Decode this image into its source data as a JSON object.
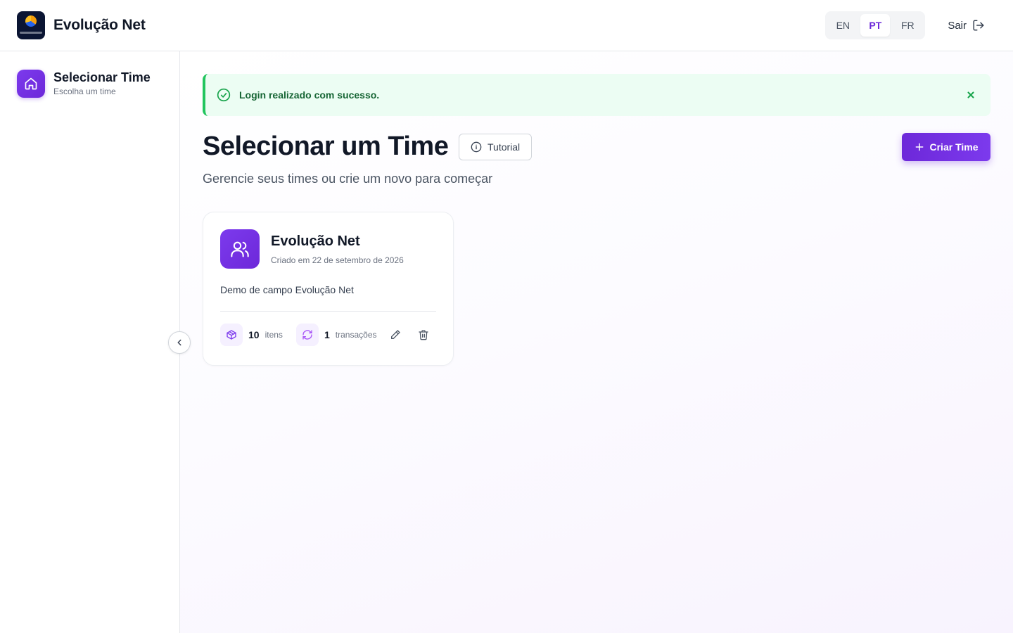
{
  "app": {
    "title": "Evolução Net"
  },
  "header": {
    "languages": [
      {
        "code": "EN",
        "active": false
      },
      {
        "code": "PT",
        "active": true
      },
      {
        "code": "FR",
        "active": false
      }
    ],
    "logout_label": "Sair"
  },
  "sidebar": {
    "item": {
      "title": "Selecionar Time",
      "subtitle": "Escolha um time",
      "icon": "home-icon"
    }
  },
  "alert": {
    "message": "Login realizado com sucesso.",
    "type": "success"
  },
  "main": {
    "title": "Selecionar um Time",
    "tutorial_label": "Tutorial",
    "create_label": "Criar Time",
    "subtitle": "Gerencie seus times ou crie um novo para começar"
  },
  "teams": [
    {
      "name": "Evolução Net",
      "created": "Criado em 22 de setembro de 2026",
      "description": "Demo de campo Evolução Net",
      "items_count": "10",
      "items_label": "itens",
      "transactions_count": "1",
      "transactions_label": "transações"
    }
  ],
  "colors": {
    "accent": "#6d28d9",
    "success_bg": "#ecfdf3",
    "success_text": "#166534",
    "success_border": "#22c55e"
  }
}
